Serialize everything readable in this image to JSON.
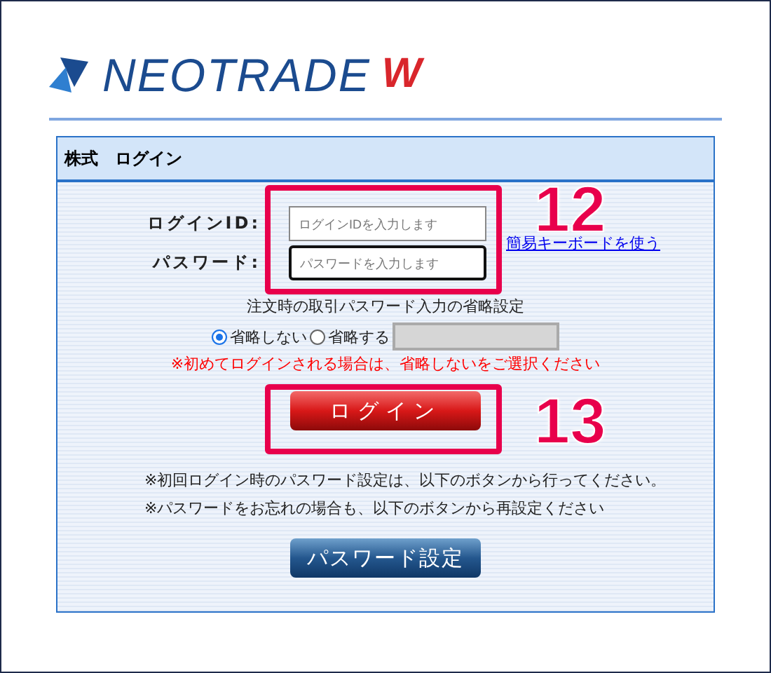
{
  "logo": {
    "text": "NEOTRADE",
    "accent": "W"
  },
  "panel": {
    "title": "株式　ログイン"
  },
  "login_form": {
    "fields": [
      {
        "label": "ログインID:",
        "placeholder": "ログインIDを入力します",
        "focused": false
      },
      {
        "label": "パスワード:",
        "placeholder": "パスワードを入力します",
        "focused": true
      }
    ],
    "keyboard_link": "簡易キーボードを使う"
  },
  "skip_setting": {
    "title": "注文時の取引パスワード入力の省略設定",
    "options": [
      {
        "label": "省略しない",
        "selected": true
      },
      {
        "label": "省略する",
        "selected": false
      }
    ],
    "warning": "※初めてログインされる場合は、省略しないをご選択ください"
  },
  "login_button": "ログイン",
  "notes": [
    "※初回ログイン時のパスワード設定は、以下のボタンから行ってください。",
    "※パスワードをお忘れの場合も、以下のボタンから再設定ください"
  ],
  "password_button": "パスワード設定",
  "annotations": [
    {
      "number": "12"
    },
    {
      "number": "13"
    }
  ]
}
